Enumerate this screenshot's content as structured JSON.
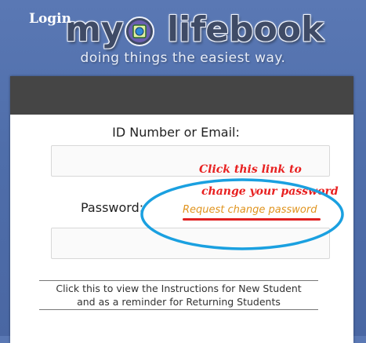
{
  "logo": {
    "word_left": "my",
    "word_right": "lifebook",
    "tagline": "doing things the easiest way."
  },
  "login": {
    "title": "Login",
    "id_label": "ID Number or Email:",
    "id_value": "",
    "password_label": "Password:",
    "password_value": "",
    "request_link": "Request change password",
    "instructions_line1": "Click this to view the Instructions for New Student",
    "instructions_line2": "and as a reminder for Returning Students"
  },
  "annotation": {
    "line1": "Click this link to",
    "line2": "change your password",
    "color": "#e82020",
    "circle_color": "#1aa0e0"
  },
  "colors": {
    "background": "#4f6eaa",
    "header": "#454545",
    "link": "#e0941f"
  }
}
